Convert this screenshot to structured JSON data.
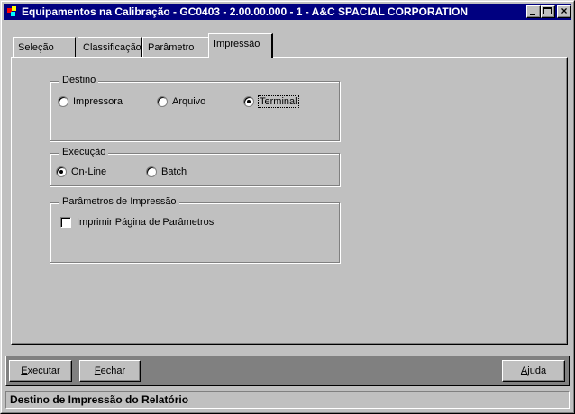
{
  "window": {
    "title": "Equipamentos na Calibração - GC0403 - 2.00.00.000 - 1 - A&C SPACIAL CORPORATION"
  },
  "tabs": [
    {
      "label": "Seleção",
      "active": false
    },
    {
      "label": "Classificação",
      "active": false
    },
    {
      "label": "Parâmetro",
      "active": false
    },
    {
      "label": "Impressão",
      "active": true
    }
  ],
  "destino": {
    "label": "Destino",
    "options": [
      {
        "label": "Impressora",
        "selected": false
      },
      {
        "label": "Arquivo",
        "selected": false
      },
      {
        "label": "Terminal",
        "selected": true
      }
    ]
  },
  "execucao": {
    "label": "Execução",
    "options": [
      {
        "label": "On-Line",
        "selected": true
      },
      {
        "label": "Batch",
        "selected": false
      }
    ]
  },
  "parametros": {
    "label": "Parâmetros de Impressão",
    "checkbox": {
      "label": "Imprimir Página de Parâmetros",
      "checked": false
    }
  },
  "buttons": {
    "executar": {
      "mnemonic": "E",
      "rest": "xecutar"
    },
    "fechar": {
      "mnemonic": "F",
      "rest": "echar"
    },
    "ajuda": {
      "mnemonic": "A",
      "rest": "juda"
    }
  },
  "status": {
    "text": "Destino de Impressão do Relatório"
  }
}
